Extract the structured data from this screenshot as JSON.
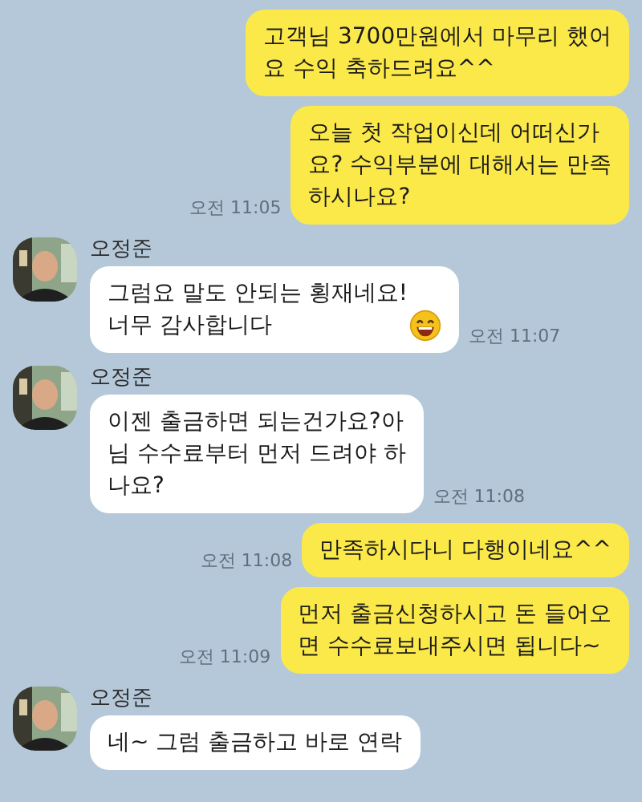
{
  "messages": [
    {
      "kind": "sent",
      "text": "고객님 3700만원에서 마무리 했어\n요 수익 축하드려요^^"
    },
    {
      "kind": "sent",
      "text": "오늘 첫 작업이신데 어떠신가\n요? 수익부분에 대해서는 만족\n하시나요?",
      "time": "오전 11:05"
    },
    {
      "kind": "received",
      "sender": "오정준",
      "text": "그럼요 말도 안되는 횡재네요!\n너무 감사합니다",
      "emoji": true,
      "time": "오전 11:07"
    },
    {
      "kind": "received",
      "sender": "오정준",
      "text": "이젠 출금하면 되는건가요?아\n님 수수료부터 먼저 드려야 하\n나요?",
      "time": "오전 11:08"
    },
    {
      "kind": "sent",
      "text": "만족하시다니 다행이네요^^",
      "time": "오전 11:08"
    },
    {
      "kind": "sent",
      "text": "먼저 출금신청하시고 돈 들어오\n면 수수료보내주시면 됩니다~",
      "time": "오전 11:09"
    },
    {
      "kind": "received",
      "sender": "오정준",
      "text": "네~ 그럼 출금하고 바로 연락"
    }
  ]
}
